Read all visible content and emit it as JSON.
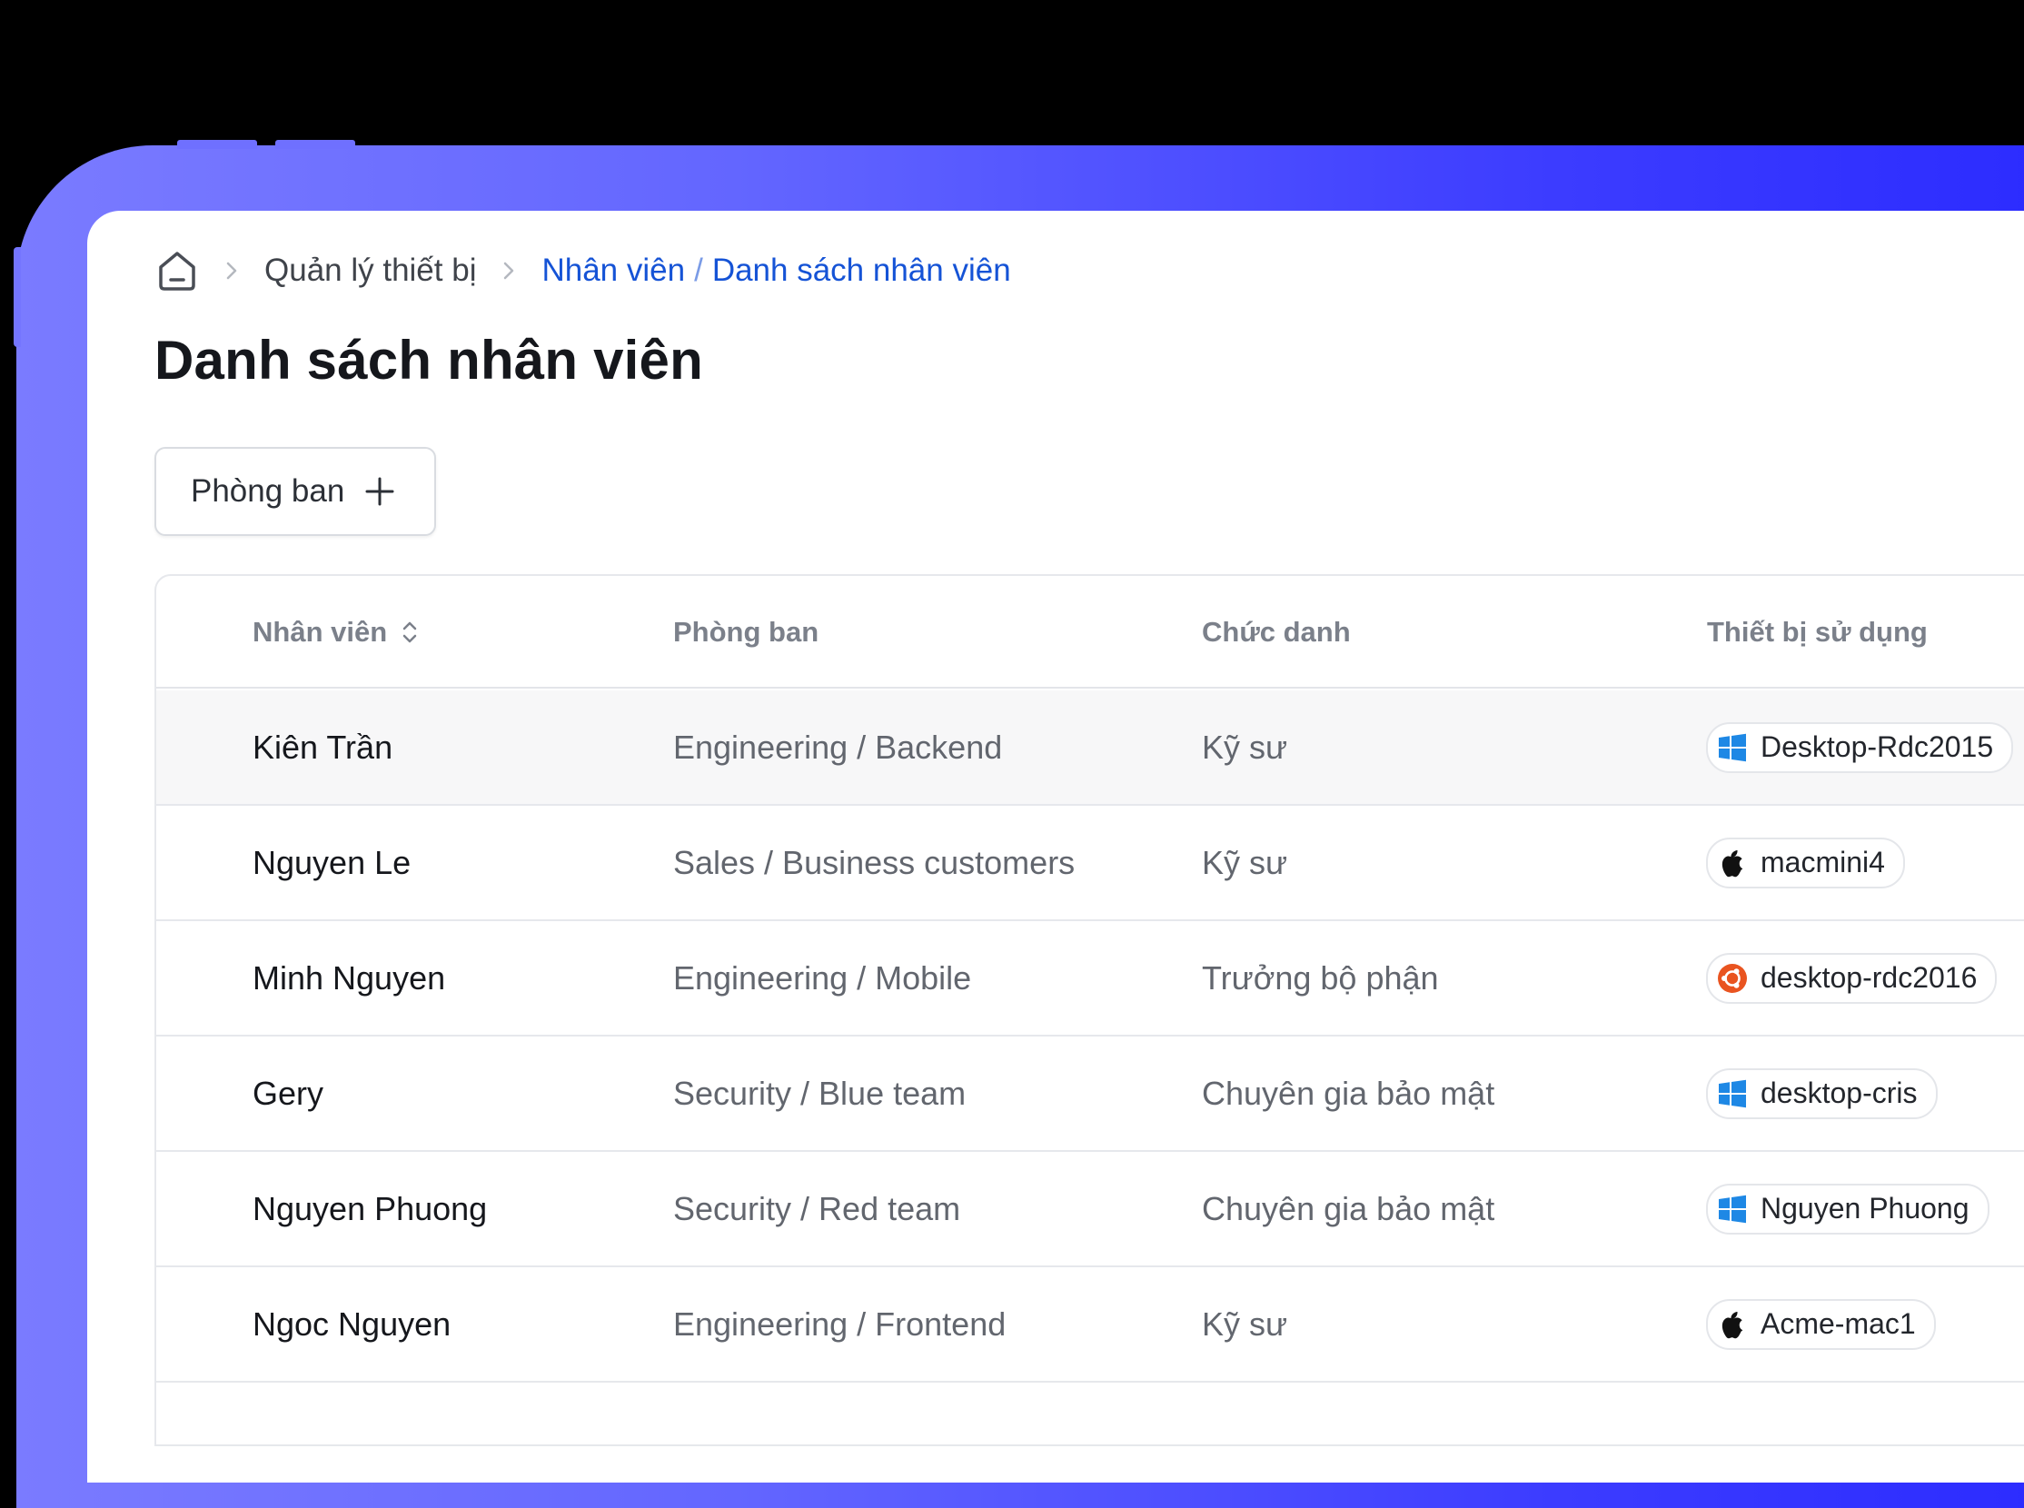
{
  "breadcrumb": {
    "home_icon": "home-icon",
    "section": "Quản lý thiết bị",
    "parent": "Nhân viên",
    "separator": "/",
    "current": "Danh sách nhân viên"
  },
  "page": {
    "title": "Danh sách nhân viên"
  },
  "toolbar": {
    "department_button_label": "Phòng ban",
    "department_button_icon": "plus-icon"
  },
  "table": {
    "columns": [
      "Nhân viên",
      "Phòng ban",
      "Chức danh",
      "Thiết bị sử dụng"
    ],
    "sortable_column": "Nhân viên",
    "rows": [
      {
        "name": "Kiên Trần",
        "department": "Engineering / Backend",
        "title": "Kỹ sư",
        "device": {
          "name": "Desktop-Rdc2015",
          "os": "windows-icon"
        }
      },
      {
        "name": "Nguyen Le",
        "department": "Sales / Business customers",
        "title": "Kỹ sư",
        "device": {
          "name": "macmini4",
          "os": "apple-icon"
        }
      },
      {
        "name": "Minh Nguyen",
        "department": "Engineering / Mobile",
        "title": "Trưởng bộ phận",
        "device": {
          "name": "desktop-rdc2016",
          "os": "ubuntu-icon"
        }
      },
      {
        "name": "Gery",
        "department": "Security / Blue team",
        "title": "Chuyên gia bảo mật",
        "device": {
          "name": "desktop-cris",
          "os": "windows-icon"
        }
      },
      {
        "name": "Nguyen Phuong",
        "department": "Security / Red team",
        "title": "Chuyên gia bảo mật",
        "device": {
          "name": "Nguyen Phuong",
          "os": "windows-icon"
        }
      },
      {
        "name": "Ngoc Nguyen",
        "department": "Engineering / Frontend",
        "title": "Kỹ sư",
        "device": {
          "name": "Acme-mac1",
          "os": "apple-icon"
        }
      }
    ]
  },
  "colors": {
    "accent": "#1553d6",
    "frame_gradient_start": "#7a7bff",
    "frame_gradient_end": "#2b2bff",
    "windows": "#1e88e5",
    "ubuntu": "#e95420"
  }
}
